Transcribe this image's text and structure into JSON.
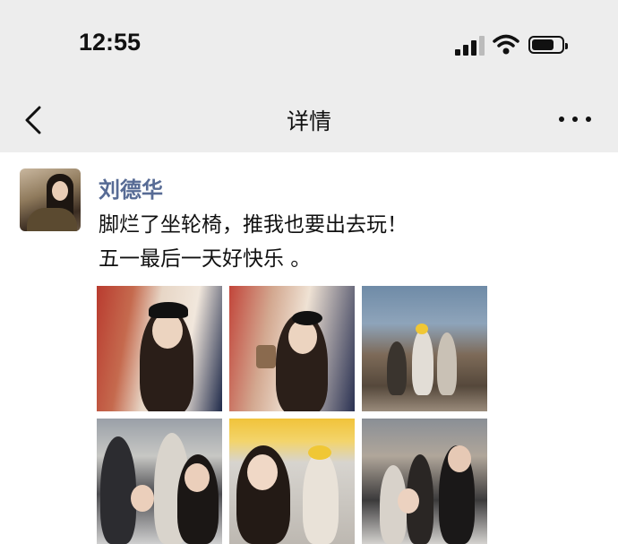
{
  "status_bar": {
    "time": "12:55",
    "icons": [
      "signal-icon",
      "wifi-icon",
      "battery-icon"
    ]
  },
  "nav": {
    "title": "详情",
    "back_icon": "chevron-left-icon",
    "more_icon": "more-dots-icon"
  },
  "post": {
    "username": "刘德华",
    "text_lines": [
      "脚烂了坐轮椅，推我也要出去玩！",
      "五一最后一天好快乐 。"
    ],
    "photo_count": 6
  },
  "colors": {
    "bar_background": "#ededed",
    "username": "#576b95",
    "text": "#111111"
  }
}
